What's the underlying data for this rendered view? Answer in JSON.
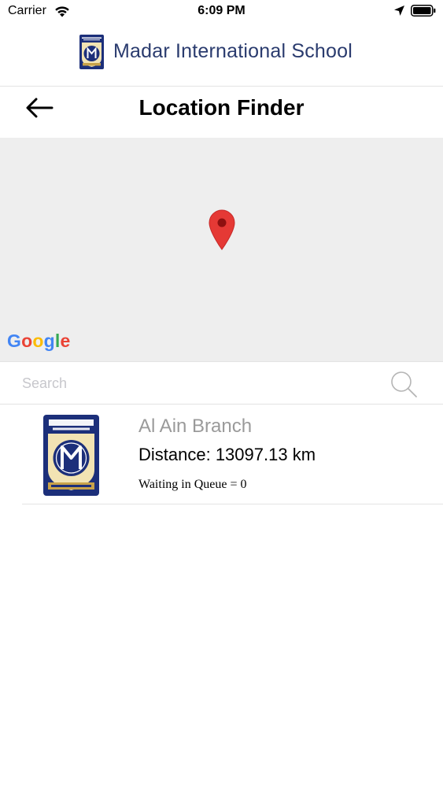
{
  "status_bar": {
    "carrier": "Carrier",
    "time": "6:09 PM",
    "icons": [
      "wifi-icon",
      "location-arrow-icon",
      "battery-icon"
    ]
  },
  "brand": {
    "name": "Madar International School",
    "logo_icon": "madar-logo-icon"
  },
  "nav": {
    "title": "Location Finder",
    "back_icon": "back-arrow-icon"
  },
  "map": {
    "provider": "Google",
    "pin_color": "#E53935",
    "background": "#EEEEEE"
  },
  "search": {
    "placeholder": "Search",
    "value": ""
  },
  "branches": [
    {
      "name": "Al Ain Branch",
      "distance": "Distance: 13097.13 km",
      "queue": "Waiting in Queue = 0"
    }
  ],
  "colors": {
    "brand_text": "#2A3B6E",
    "secondary_text": "#9A9A9A",
    "divider": "#E3E3E3"
  }
}
